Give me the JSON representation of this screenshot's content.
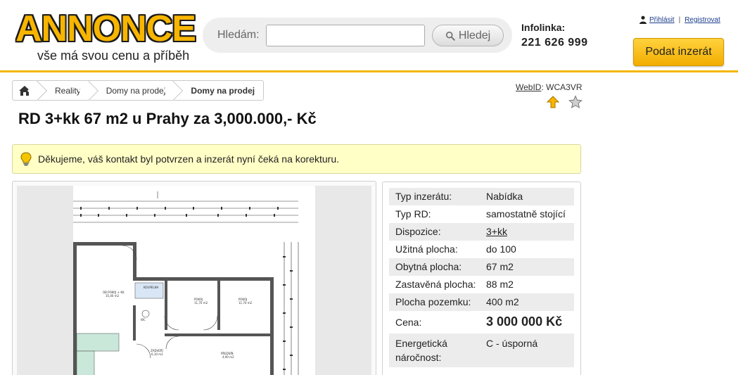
{
  "header": {
    "logo_text": "ANNONCE",
    "slogan": "vše má svou cenu a příběh",
    "search": {
      "label": "Hledám:",
      "value": "",
      "button": "Hledej"
    },
    "infolinka": {
      "title": "Infolinka:",
      "phone": "221 626 999"
    },
    "user": {
      "login": "Přihlásit",
      "separator": "|",
      "register": "Registrovat"
    },
    "post_button": "Podat inzerát"
  },
  "breadcrumb": {
    "items": [
      "Reality",
      "Domy na prodej",
      "Domy na prodej"
    ]
  },
  "webid": {
    "label": "WebID",
    "value": "WCA3VR"
  },
  "listing": {
    "title": "RD 3+kk 67 m2 u Prahy za 3,000.000,- Kč",
    "notice": "Děkujeme, váš kontakt byl potvrzen a inzerát nyní čeká na korekturu."
  },
  "params": [
    {
      "key": "Typ inzerátu:",
      "value": "Nabídka"
    },
    {
      "key": "Typ RD:",
      "value": "samostatně stojící"
    },
    {
      "key": "Dispozice:",
      "value": "3+kk"
    },
    {
      "key": "Užitná plocha:",
      "value": "do 100"
    },
    {
      "key": "Obytná plocha:",
      "value": "67 m2"
    },
    {
      "key": "Zastavěná plocha:",
      "value": "88 m2"
    },
    {
      "key": "Plocha pozemku:",
      "value": "400 m2"
    },
    {
      "key": "Cena:",
      "value": "3 000 000 Kč"
    },
    {
      "key": "Energetická náročnost:",
      "value": "C - úsporná"
    }
  ],
  "colors": {
    "accent": "#f2b600",
    "notice_bg": "#ffffc6",
    "link": "#1a3c8c"
  },
  "icons": [
    "home-icon",
    "user-icon",
    "search-icon",
    "arrow-up-icon",
    "star-icon",
    "lightbulb-icon"
  ]
}
